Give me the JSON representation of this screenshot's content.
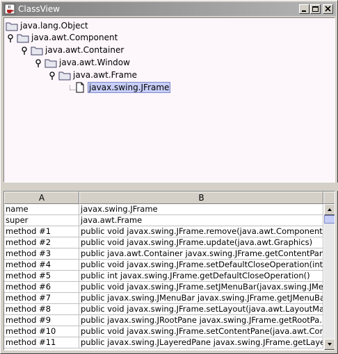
{
  "window": {
    "title": "ClassView",
    "app_icon": "java-cup-icon",
    "controls": [
      "minimize-icon",
      "maximize-icon",
      "close-icon"
    ]
  },
  "tree": {
    "nodes": [
      {
        "label": "java.lang.Object",
        "icon": "folder-icon",
        "expanded": true
      },
      {
        "label": "java.awt.Component",
        "icon": "folder-icon",
        "expanded": true
      },
      {
        "label": "java.awt.Container",
        "icon": "folder-icon",
        "expanded": true
      },
      {
        "label": "java.awt.Window",
        "icon": "folder-icon",
        "expanded": true
      },
      {
        "label": "java.awt.Frame",
        "icon": "folder-icon",
        "expanded": true
      },
      {
        "label": "javax.swing.JFrame",
        "icon": "file-icon",
        "selected": true
      }
    ]
  },
  "table": {
    "columns": [
      "A",
      "B"
    ],
    "rows": [
      {
        "a": "name",
        "b": "javax.swing.JFrame"
      },
      {
        "a": "super",
        "b": "java.awt.Frame"
      },
      {
        "a": "method #1",
        "b": "public void javax.swing.JFrame.remove(java.awt.Component)"
      },
      {
        "a": "method #2",
        "b": "public void javax.swing.JFrame.update(java.awt.Graphics)"
      },
      {
        "a": "method #3",
        "b": "public java.awt.Container javax.swing.JFrame.getContentPane()"
      },
      {
        "a": "method #4",
        "b": "public void javax.swing.JFrame.setDefaultCloseOperation(int)"
      },
      {
        "a": "method #5",
        "b": "public int javax.swing.JFrame.getDefaultCloseOperation()"
      },
      {
        "a": "method #6",
        "b": "public void javax.swing.JFrame.setJMenuBar(javax.swing.JMe..."
      },
      {
        "a": "method #7",
        "b": "public javax.swing.JMenuBar javax.swing.JFrame.getJMenuBa..."
      },
      {
        "a": "method #8",
        "b": "public void javax.swing.JFrame.setLayout(java.awt.LayoutMan..."
      },
      {
        "a": "method #9",
        "b": "public javax.swing.JRootPane javax.swing.JFrame.getRootPa..."
      },
      {
        "a": "method #10",
        "b": "public void javax.swing.JFrame.setContentPane(java.awt.Cont..."
      },
      {
        "a": "method #11",
        "b": "public javax.swing.JLayeredPane javax.swing.JFrame.getLaye..."
      }
    ]
  },
  "colors": {
    "tree_background": "#fdf6fb",
    "selection": "#c7cef7",
    "titlebar_start": "#808080",
    "titlebar_end": "#b5b5b5"
  }
}
